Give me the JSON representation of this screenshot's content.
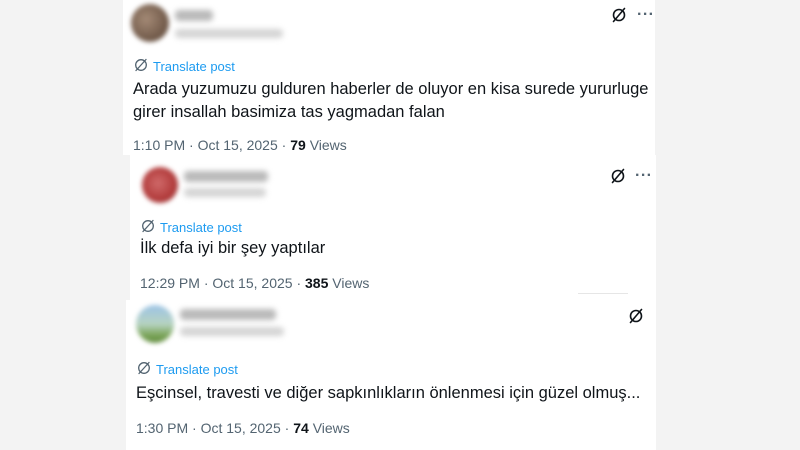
{
  "icons": {
    "grok": "grok-slash-circle-icon",
    "more": "more-dots-icon",
    "translate": "translate-globe-icon"
  },
  "colors": {
    "link_blue": "#1d9bf0",
    "text_primary": "#0f1419",
    "text_secondary": "#536471"
  },
  "posts": [
    {
      "translate_label": "Translate post",
      "text_lines": [
        "Arada yuzumuzu gulduren haberler de oluyor en kisa surede yururluge",
        "girer insallah basimiza tas yagmadan falan"
      ],
      "time": "1:10 PM",
      "date": "Oct 15, 2025",
      "views_count": "79",
      "views_label": "Views",
      "separator": "·"
    },
    {
      "translate_label": "Translate post",
      "text_lines": [
        "İlk defa iyi bir şey yaptılar"
      ],
      "time": "12:29 PM",
      "date": "Oct 15, 2025",
      "views_count": "385",
      "views_label": "Views",
      "separator": "·"
    },
    {
      "translate_label": "Translate post",
      "text_lines": [
        "Eşcinsel, travesti ve diğer sapkınlıkların önlenmesi için güzel olmuş..."
      ],
      "time": "1:30 PM",
      "date": "Oct 15, 2025",
      "views_count": "74",
      "views_label": "Views",
      "separator": "·"
    }
  ]
}
